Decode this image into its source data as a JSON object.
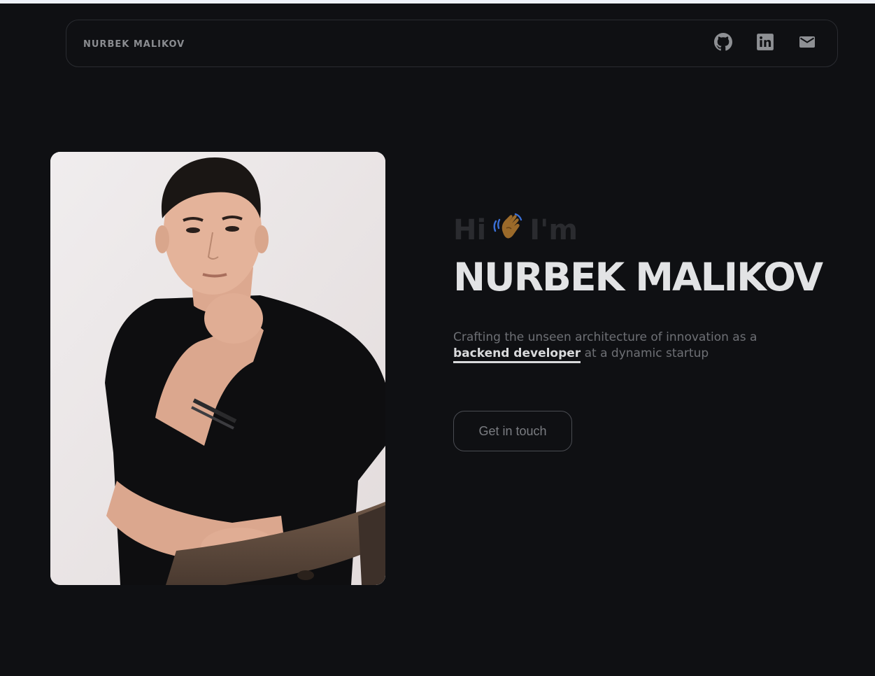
{
  "header": {
    "brand": "NURBEK MALIKOV",
    "icons": [
      "github-icon",
      "linkedin-icon",
      "mail-icon"
    ]
  },
  "hero": {
    "greeting_prefix": "Hi",
    "greeting_emoji": "👋",
    "greeting_suffix": "I'm",
    "name": "NURBEK MALIKOV",
    "tagline_before": "Crafting the unseen architecture of innovation as a",
    "tagline_role": "backend developer",
    "tagline_after": "at a dynamic startup",
    "cta_label": "Get in touch",
    "photo_icon": "portrait-photo"
  },
  "colors": {
    "background": "#0f1013",
    "heading": "#e2e3e5",
    "muted_text": "#6e7075",
    "border": "#2a2c31"
  }
}
